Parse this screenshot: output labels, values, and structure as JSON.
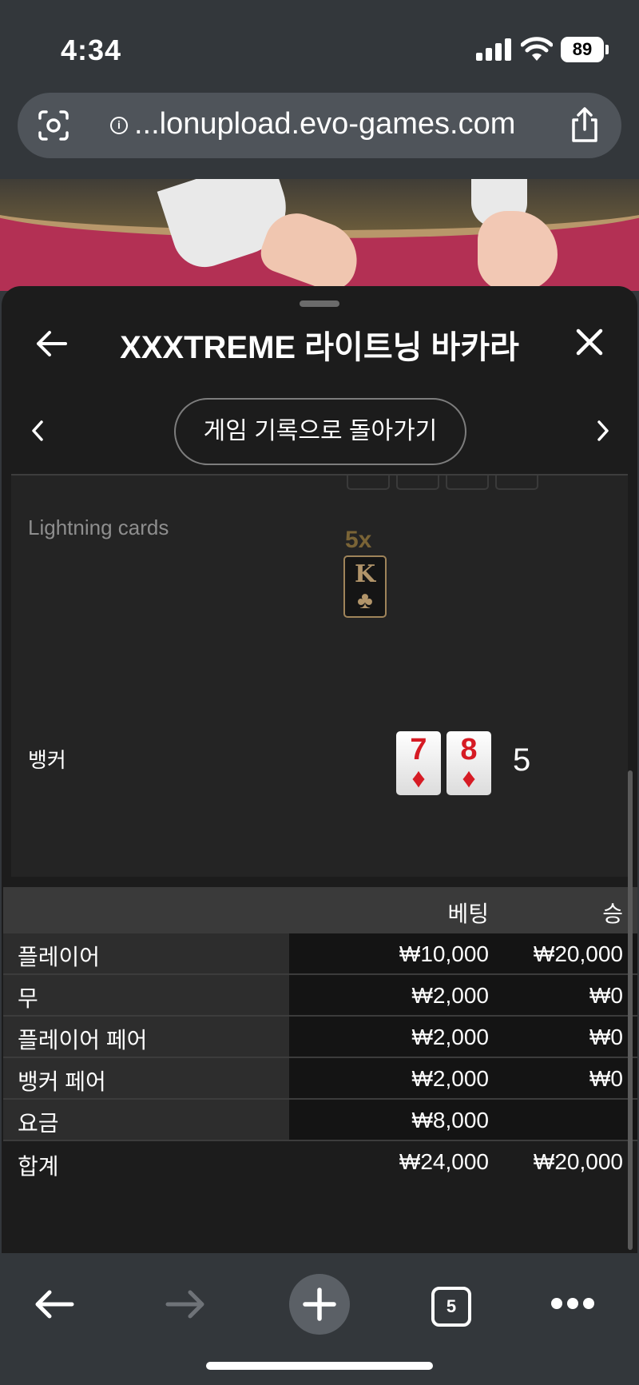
{
  "status_bar": {
    "time": "4:34",
    "battery": "89"
  },
  "browser": {
    "url": "...lonupload.evo-games.com",
    "tab_count": "5"
  },
  "header": {
    "title": "XXXTREME 라이트닝 바카라"
  },
  "history_nav": {
    "back_to_history_label": "게임 기록으로 돌아가기"
  },
  "lightning": {
    "label": "Lightning cards",
    "cards": [
      {
        "multiplier": "5x",
        "rank": "K",
        "suit": "♣"
      }
    ]
  },
  "banker": {
    "label": "뱅커",
    "cards": [
      {
        "rank": "7",
        "suit": "♦"
      },
      {
        "rank": "8",
        "suit": "♦"
      }
    ],
    "score": "5"
  },
  "bets_table": {
    "headers": {
      "bet": "베팅",
      "win": "승"
    },
    "rows": [
      {
        "name": "플레이어",
        "bet": "₩10,000",
        "win": "₩20,000"
      },
      {
        "name": "무",
        "bet": "₩2,000",
        "win": "₩0"
      },
      {
        "name": "플레이어 페어",
        "bet": "₩2,000",
        "win": "₩0"
      },
      {
        "name": "뱅커 페어",
        "bet": "₩2,000",
        "win": "₩0"
      },
      {
        "name": "요금",
        "bet": "₩8,000",
        "win": ""
      }
    ],
    "total": {
      "name": "합계",
      "bet": "₩24,000",
      "win": "₩20,000"
    }
  },
  "colors": {
    "felt": "#b33054",
    "card_red": "#d61b24",
    "lightning_gold": "#9f845a"
  }
}
